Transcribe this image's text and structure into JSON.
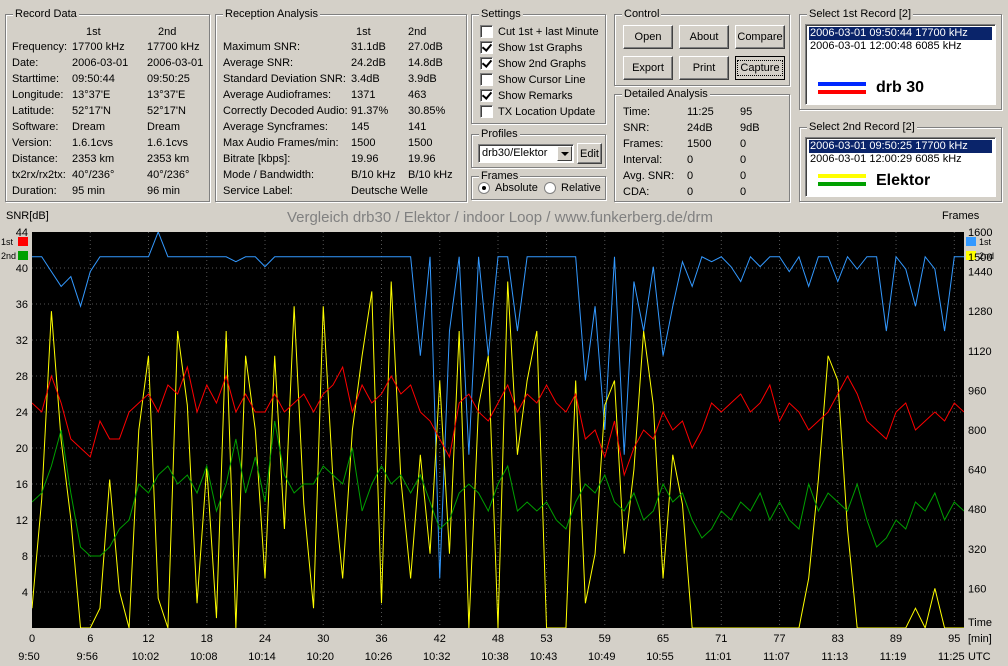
{
  "record_data": {
    "title": "Record Data",
    "col1": "1st",
    "col2": "2nd",
    "rows": [
      {
        "label": "Frequency:",
        "v1": "17700 kHz",
        "v2": "17700 kHz"
      },
      {
        "label": "Date:",
        "v1": "2006-03-01",
        "v2": "2006-03-01"
      },
      {
        "label": "Starttime:",
        "v1": "09:50:44",
        "v2": "09:50:25"
      },
      {
        "label": "Longitude:",
        "v1": "13°37'E",
        "v2": "13°37'E"
      },
      {
        "label": "Latitude:",
        "v1": "52°17'N",
        "v2": "52°17'N"
      },
      {
        "label": "Software:",
        "v1": "Dream",
        "v2": "Dream"
      },
      {
        "label": "Version:",
        "v1": "1.6.1cvs",
        "v2": "1.6.1cvs"
      },
      {
        "label": "Distance:",
        "v1": "2353 km",
        "v2": "2353 km"
      },
      {
        "label": "tx2rx/rx2tx:",
        "v1": "40°/236°",
        "v2": "40°/236°"
      },
      {
        "label": "Duration:",
        "v1": "95 min",
        "v2": "96 min"
      }
    ]
  },
  "reception": {
    "title": "Reception Analysis",
    "col1": "1st",
    "col2": "2nd",
    "rows": [
      {
        "label": "Maximum SNR:",
        "v1": "31.1dB",
        "v2": "27.0dB"
      },
      {
        "label": "Average SNR:",
        "v1": "24.2dB",
        "v2": "14.8dB"
      },
      {
        "label": "Standard Deviation SNR:",
        "v1": "3.4dB",
        "v2": "3.9dB"
      },
      {
        "label": "Average Audioframes:",
        "v1": "1371",
        "v2": "463"
      },
      {
        "label": "Correctly Decoded Audio:",
        "v1": "91.37%",
        "v2": "30.85%"
      },
      {
        "label": "Average Syncframes:",
        "v1": "145",
        "v2": "141"
      },
      {
        "label": "Max Audio Frames/min:",
        "v1": "1500",
        "v2": "1500"
      },
      {
        "label": "Bitrate [kbps]:",
        "v1": "19.96",
        "v2": "19.96"
      },
      {
        "label": "Mode / Bandwidth:",
        "v1": "B/10 kHz",
        "v2": "B/10 kHz"
      },
      {
        "label": "Service Label:",
        "v1": "Deutsche Welle",
        "v2": ""
      }
    ]
  },
  "settings": {
    "title": "Settings",
    "items": [
      {
        "label": "Cut 1st + last Minute",
        "checked": false
      },
      {
        "label": "Show 1st Graphs",
        "checked": true
      },
      {
        "label": "Show 2nd Graphs",
        "checked": true
      },
      {
        "label": "Show Cursor Line",
        "checked": false
      },
      {
        "label": "Show Remarks",
        "checked": true
      },
      {
        "label": "TX Location Update",
        "checked": false
      }
    ]
  },
  "profiles": {
    "title": "Profiles",
    "selected": "drb30/Elektor",
    "edit_label": "Edit"
  },
  "frames": {
    "title": "Frames",
    "absolute": "Absolute",
    "relative": "Relative",
    "selected": "absolute"
  },
  "control": {
    "title": "Control",
    "open": "Open",
    "about": "About",
    "compare": "Compare",
    "export": "Export",
    "print": "Print",
    "capture": "Capture"
  },
  "detailed": {
    "title": "Detailed Analysis",
    "rows": [
      {
        "label": "Time:",
        "v1": "11:25",
        "v2": "95"
      },
      {
        "label": "SNR:",
        "v1": "24dB",
        "v2": "9dB"
      },
      {
        "label": "Frames:",
        "v1": "1500",
        "v2": "0"
      },
      {
        "label": "Interval:",
        "v1": "0",
        "v2": "0"
      },
      {
        "label": "Avg. SNR:",
        "v1": "0",
        "v2": "0"
      },
      {
        "label": "CDA:",
        "v1": "0",
        "v2": "0"
      }
    ]
  },
  "select1": {
    "title": "Select 1st Record [2]",
    "items": [
      "2006-03-01 09:50:44 17700 kHz",
      "2006-03-01 12:00:48 6085 kHz"
    ],
    "selected_index": 0,
    "legend_name": "drb 30",
    "colors": [
      "#0028ff",
      "#ff0000"
    ]
  },
  "select2": {
    "title": "Select 2nd Record [2]",
    "items": [
      "2006-03-01 09:50:25 17700 kHz",
      "2006-03-01 12:00:29 6085 kHz"
    ],
    "selected_index": 0,
    "legend_name": "Elektor",
    "colors": [
      "#ffff00",
      "#00a000"
    ]
  },
  "chart_data": {
    "type": "line",
    "title": "Vergleich drb30 / Elektor / indoor Loop / www.funkerberg.de/drm",
    "ylabel_left": "SNR[dB]",
    "ylabel_right": "Frames",
    "xlabel_unit": "[min]",
    "xlabel_time": "Time",
    "utc_label": "UTC",
    "legend_left": [
      {
        "label": "1st",
        "color": "#ff0000"
      },
      {
        "label": "2nd",
        "color": "#00a000"
      }
    ],
    "legend_right": [
      {
        "label": "1st",
        "color": "#3399ff"
      },
      {
        "label": "2nd",
        "color": "#ffff00"
      }
    ],
    "ylim_left": [
      0,
      44
    ],
    "ylim_right": [
      0,
      1600
    ],
    "yticks_left": [
      4,
      8,
      12,
      16,
      20,
      24,
      28,
      32,
      36,
      40,
      44
    ],
    "yticks_right": [
      160,
      320,
      480,
      640,
      800,
      960,
      1120,
      1280,
      1440,
      1500,
      1600
    ],
    "xlim": [
      0,
      96
    ],
    "xticks": [
      {
        "min": 0,
        "time": "9:50"
      },
      {
        "min": 6,
        "time": "9:56"
      },
      {
        "min": 12,
        "time": "10:02"
      },
      {
        "min": 18,
        "time": "10:08"
      },
      {
        "min": 24,
        "time": "10:14"
      },
      {
        "min": 30,
        "time": "10:20"
      },
      {
        "min": 36,
        "time": "10:26"
      },
      {
        "min": 42,
        "time": "10:32"
      },
      {
        "min": 48,
        "time": "10:38"
      },
      {
        "min": 53,
        "time": "10:43"
      },
      {
        "min": 59,
        "time": "10:49"
      },
      {
        "min": 65,
        "time": "10:55"
      },
      {
        "min": 71,
        "time": "11:01"
      },
      {
        "min": 77,
        "time": "11:07"
      },
      {
        "min": 83,
        "time": "11:13"
      },
      {
        "min": 89,
        "time": "11:19"
      },
      {
        "min": 95,
        "time": "11:25"
      }
    ],
    "series": [
      {
        "name": "1st",
        "axis": "left",
        "color": "#ff0000",
        "values": [
          25,
          24,
          28,
          25,
          21,
          20,
          19,
          23,
          21,
          21,
          24,
          25,
          26,
          24,
          27,
          26,
          29,
          24,
          27,
          25,
          28,
          24,
          26,
          24,
          24,
          26,
          24,
          25,
          26,
          24,
          26,
          27,
          29,
          24,
          27,
          25,
          26,
          28,
          26,
          27,
          24,
          23,
          21,
          19,
          25,
          26,
          24,
          23,
          25,
          27,
          24,
          26,
          25,
          27,
          25,
          24,
          26,
          21,
          22,
          19,
          23,
          17,
          20,
          22,
          21,
          24,
          22,
          23,
          20,
          22,
          25,
          24,
          25,
          26,
          24,
          25,
          27,
          23,
          25,
          24,
          22,
          23,
          24,
          26,
          28,
          26,
          23,
          22,
          21,
          24,
          25,
          22,
          23,
          24,
          23,
          25,
          24
        ]
      },
      {
        "name": "2nd",
        "axis": "left",
        "color": "#00a000",
        "values": [
          14,
          15,
          18,
          22,
          15,
          9,
          8,
          8,
          9,
          11,
          12,
          16,
          15,
          17,
          18,
          16,
          17,
          15,
          18,
          13,
          16,
          21,
          15,
          19,
          14,
          23,
          17,
          15,
          16,
          16,
          18,
          17,
          16,
          20,
          13,
          16,
          18,
          16,
          17,
          15,
          17,
          14,
          11,
          12,
          15,
          16,
          15,
          13,
          16,
          18,
          13,
          14,
          13,
          14,
          12,
          11,
          14,
          16,
          15,
          17,
          14,
          13,
          15,
          12,
          13,
          16,
          14,
          15,
          12,
          10,
          11,
          13,
          12,
          14,
          13,
          15,
          12,
          14,
          12,
          11,
          16,
          13,
          15,
          14,
          13,
          16,
          12,
          9,
          10,
          12,
          11,
          14,
          13,
          15,
          12,
          14,
          13
        ]
      },
      {
        "name": "1st",
        "axis": "right",
        "color": "#3399ff",
        "values": [
          1500,
          1500,
          1440,
          1380,
          1420,
          1300,
          1440,
          1500,
          1500,
          1500,
          1500,
          1500,
          1500,
          1600,
          1500,
          1500,
          1500,
          1500,
          1500,
          1500,
          1500,
          1480,
          1500,
          1500,
          1460,
          1500,
          1500,
          1500,
          1500,
          1500,
          1500,
          1500,
          1500,
          1500,
          1500,
          1500,
          1500,
          1500,
          1500,
          1500,
          1100,
          1500,
          200,
          1200,
          1500,
          700,
          1500,
          1100,
          1500,
          1500,
          1200,
          1500,
          1500,
          1500,
          1500,
          1500,
          1500,
          1000,
          1300,
          800,
          1500,
          700,
          1400,
          1200,
          1460,
          1100,
          1300,
          1480,
          1380,
          1500,
          1480,
          1500,
          1460,
          1400,
          1500,
          1460,
          1500,
          1500,
          1440,
          1500,
          1380,
          1500,
          1500,
          1400,
          1500,
          1450,
          1500,
          1500,
          1200,
          1500,
          1450,
          1300,
          1500,
          1450,
          1200,
          1500,
          1500
        ]
      },
      {
        "name": "2nd",
        "axis": "right",
        "color": "#ffff00",
        "values": [
          80,
          520,
          1280,
          760,
          440,
          0,
          0,
          80,
          600,
          150,
          0,
          800,
          1100,
          120,
          0,
          1200,
          900,
          100,
          650,
          40,
          1200,
          0,
          1100,
          800,
          200,
          1100,
          400,
          1300,
          500,
          80,
          1300,
          600,
          200,
          800,
          1100,
          1360,
          100,
          1400,
          600,
          200,
          700,
          300,
          1000,
          300,
          1200,
          0,
          900,
          1100,
          0,
          1400,
          700,
          1000,
          1200,
          0,
          0,
          0,
          1000,
          100,
          300,
          900,
          1000,
          300,
          640,
          1200,
          900,
          200,
          700,
          500,
          0,
          0,
          0,
          0,
          0,
          0,
          0,
          0,
          0,
          0,
          0,
          0,
          200,
          600,
          1100,
          1000,
          400,
          0,
          0,
          0,
          0,
          0,
          0,
          80,
          0,
          160,
          0,
          0,
          0
        ]
      }
    ]
  }
}
